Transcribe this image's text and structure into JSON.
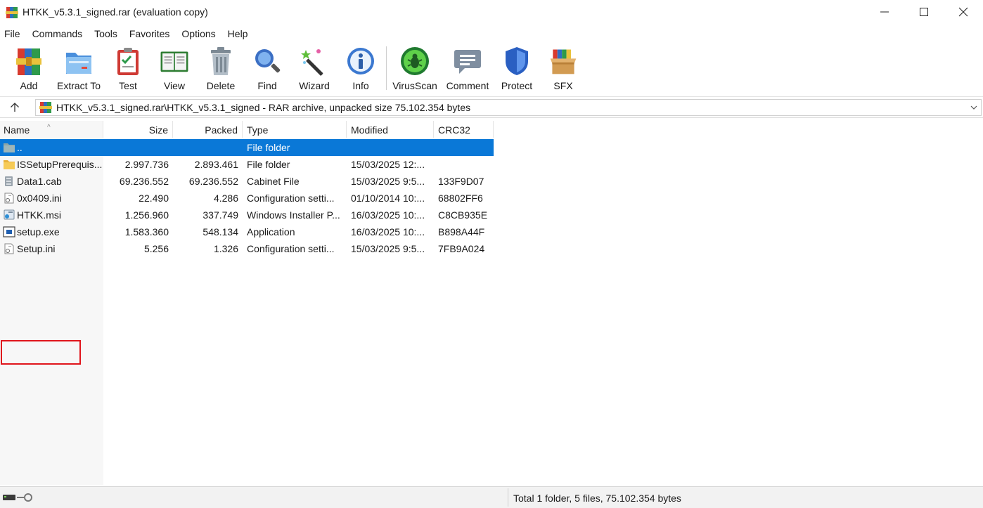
{
  "window": {
    "title": "HTKK_v5.3.1_signed.rar (evaluation copy)"
  },
  "menu": [
    "File",
    "Commands",
    "Tools",
    "Favorites",
    "Options",
    "Help"
  ],
  "toolbar": {
    "add": "Add",
    "extract_to": "Extract To",
    "test": "Test",
    "view": "View",
    "delete": "Delete",
    "find": "Find",
    "wizard": "Wizard",
    "info": "Info",
    "virusscan": "VirusScan",
    "comment": "Comment",
    "protect": "Protect",
    "sfx": "SFX"
  },
  "address": {
    "path": "HTKK_v5.3.1_signed.rar\\HTKK_v5.3.1_signed - RAR archive, unpacked size 75.102.354 bytes"
  },
  "columns": {
    "name": "Name",
    "size": "Size",
    "packed": "Packed",
    "type": "Type",
    "modified": "Modified",
    "crc32": "CRC32"
  },
  "files": [
    {
      "name": "..",
      "size": "",
      "packed": "",
      "type": "File folder",
      "modified": "",
      "crc": "",
      "icon": "folder-up-icon"
    },
    {
      "name": "ISSetupPrerequis...",
      "size": "2.997.736",
      "packed": "2.893.461",
      "type": "File folder",
      "modified": "15/03/2025 12:...",
      "crc": "",
      "icon": "folder-icon"
    },
    {
      "name": "Data1.cab",
      "size": "69.236.552",
      "packed": "69.236.552",
      "type": "Cabinet File",
      "modified": "15/03/2025 9:5...",
      "crc": "133F9D07",
      "icon": "cabinet-file-icon"
    },
    {
      "name": "0x0409.ini",
      "size": "22.490",
      "packed": "4.286",
      "type": "Configuration setti...",
      "modified": "01/10/2014 10:...",
      "crc": "68802FF6",
      "icon": "ini-file-icon"
    },
    {
      "name": "HTKK.msi",
      "size": "1.256.960",
      "packed": "337.749",
      "type": "Windows Installer P...",
      "modified": "16/03/2025 10:...",
      "crc": "C8CB935E",
      "icon": "msi-file-icon"
    },
    {
      "name": "setup.exe",
      "size": "1.583.360",
      "packed": "548.134",
      "type": "Application",
      "modified": "16/03/2025 10:...",
      "crc": "B898A44F",
      "icon": "exe-file-icon"
    },
    {
      "name": "Setup.ini",
      "size": "5.256",
      "packed": "1.326",
      "type": "Configuration setti...",
      "modified": "15/03/2025 9:5...",
      "crc": "7FB9A024",
      "icon": "ini-file-icon"
    }
  ],
  "selected_row": 0,
  "highlighted_row": 5,
  "status": {
    "total": "Total 1 folder, 5 files, 75.102.354 bytes"
  },
  "colors": {
    "selection": "#0a78d7",
    "highlight_border": "#e0151c"
  }
}
